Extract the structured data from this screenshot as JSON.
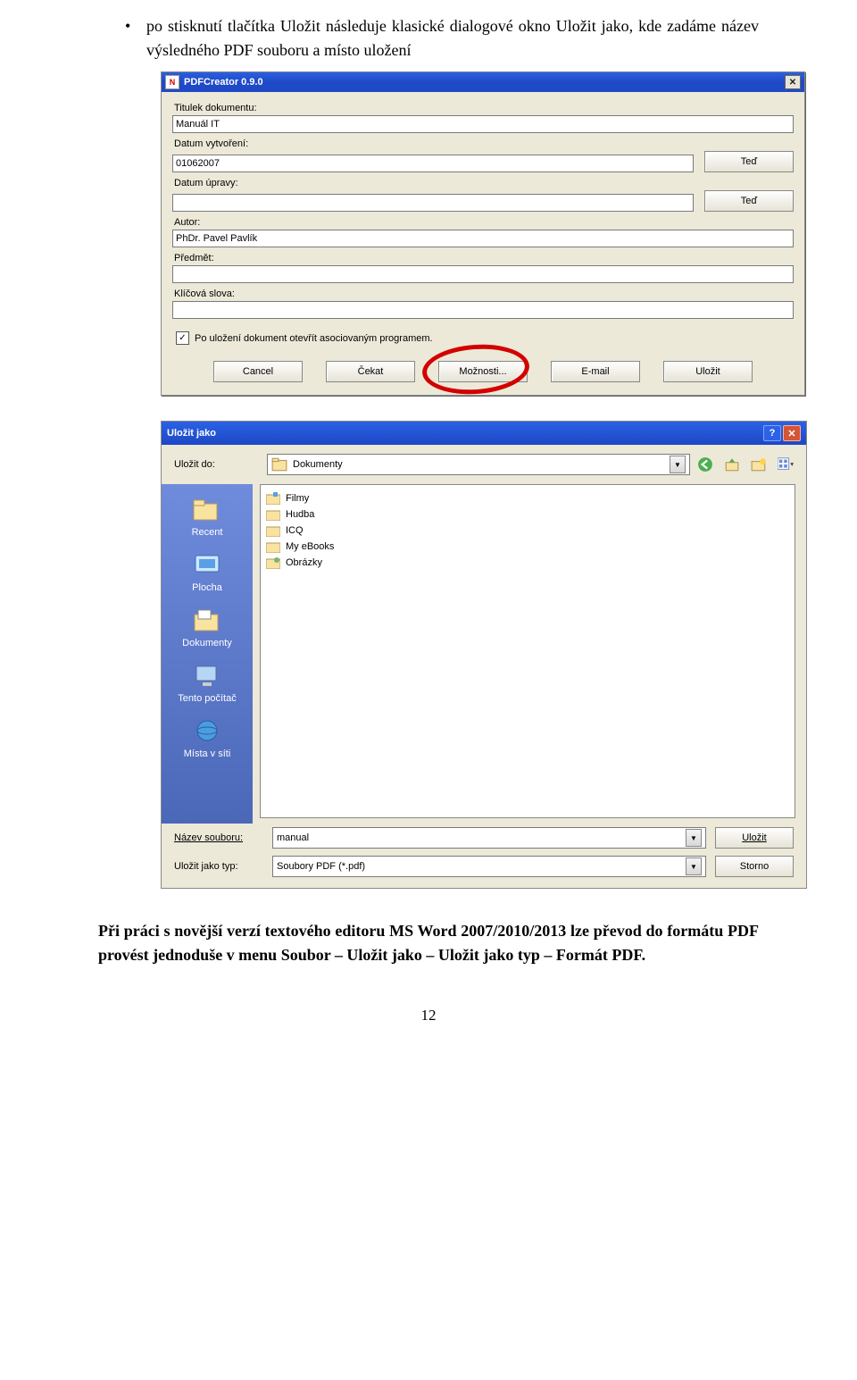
{
  "bullet_text": "po stisknutí tlačítka Uložit následuje klasické dialogové okno Uložit jako, kde zadáme název výsledného PDF souboru a místo uložení",
  "dlg1": {
    "title": "PDFCreator 0.9.0",
    "labels": {
      "titulek": "Titulek dokumentu:",
      "datum_vyt": "Datum vytvoření:",
      "datum_upr": "Datum úpravy:",
      "autor": "Autor:",
      "predmet": "Předmět:",
      "klicova": "Klíčová slova:"
    },
    "values": {
      "titulek": "Manuál IT",
      "datum_vyt": "01062007",
      "datum_upr": "",
      "autor": "PhDr. Pavel Pavlík",
      "predmet": "",
      "klicova": ""
    },
    "ted_btn": "Teď",
    "checkbox_text": "Po uložení dokument otevřít asociovaným programem.",
    "buttons": [
      "Cancel",
      "Čekat",
      "Možnosti...",
      "E-mail",
      "Uložit"
    ]
  },
  "dlg2": {
    "title": "Uložit jako",
    "ulozit_do_label": "Uložit do:",
    "ulozit_do_value": "Dokumenty",
    "places": [
      "Recent",
      "Plocha",
      "Dokumenty",
      "Tento počítač",
      "Místa v síti"
    ],
    "files": [
      "Filmy",
      "Hudba",
      "ICQ",
      "My eBooks",
      "Obrázky"
    ],
    "name_label": "Název souboru:",
    "name_value": "manual",
    "type_label": "Uložit jako typ:",
    "type_value": "Soubory PDF (*.pdf)",
    "btn_save": "Uložit",
    "btn_cancel": "Storno"
  },
  "para_pre": "Při práci s novější verzí textového editoru MS Word 2007/2010/2013 lze převod do formátu PDF provést jednoduše v menu Soubor – Uložit jako – Uložit jako typ – Formát PDF.",
  "page_number": "12"
}
